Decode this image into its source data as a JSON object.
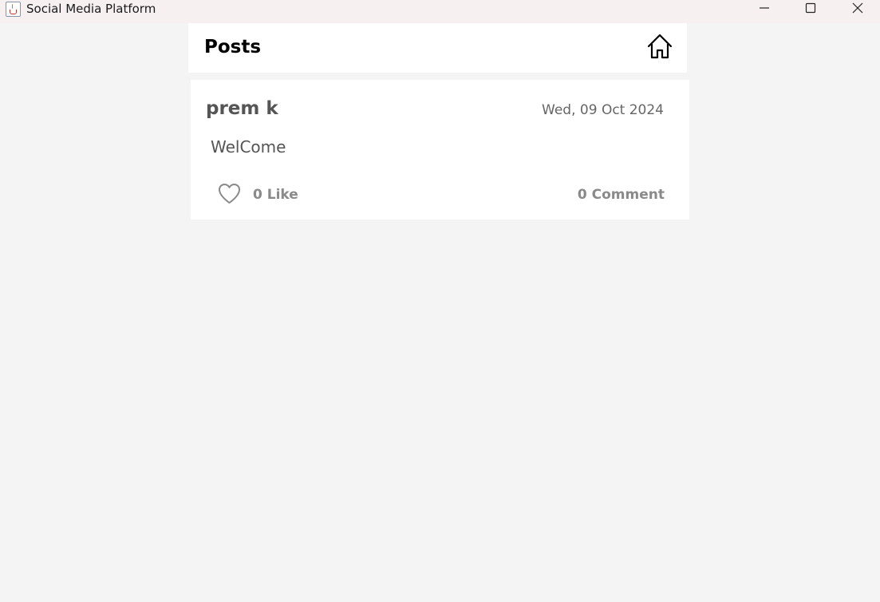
{
  "window": {
    "title": "Social Media Platform",
    "icon": "java-cup-icon"
  },
  "header": {
    "title": "Posts",
    "home_icon": "home-icon"
  },
  "posts": [
    {
      "author": "prem k",
      "date": "Wed, 09 Oct 2024",
      "content": "WelCome",
      "like_label": "0 Like",
      "comment_label": "0 Comment",
      "like_icon": "heart-outline-icon"
    }
  ],
  "colors": {
    "background": "#f4f4f4",
    "titlebar": "#f7f0f1",
    "card": "#ffffff",
    "author_text": "#555555",
    "meta_text": "#8a8a8a"
  }
}
